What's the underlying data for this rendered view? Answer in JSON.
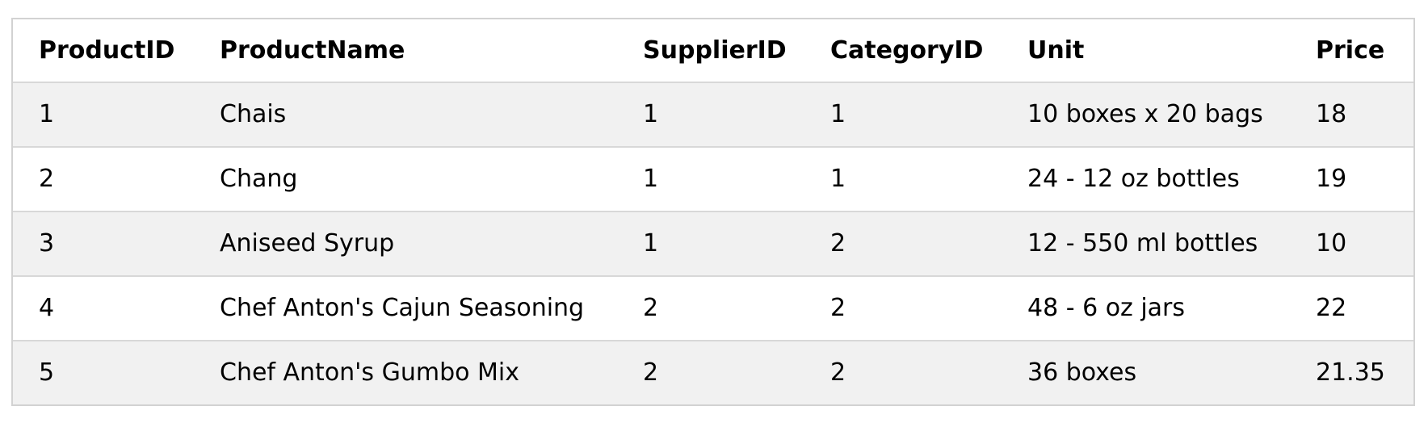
{
  "table": {
    "headers": [
      "ProductID",
      "ProductName",
      "SupplierID",
      "CategoryID",
      "Unit",
      "Price"
    ],
    "rows": [
      [
        "1",
        "Chais",
        "1",
        "1",
        "10 boxes x 20 bags",
        "18"
      ],
      [
        "2",
        "Chang",
        "1",
        "1",
        "24 - 12 oz bottles",
        "19"
      ],
      [
        "3",
        "Aniseed Syrup",
        "1",
        "2",
        "12 - 550 ml bottles",
        "10"
      ],
      [
        "4",
        "Chef Anton's Cajun Seasoning",
        "2",
        "2",
        "48 - 6 oz jars",
        "22"
      ],
      [
        "5",
        "Chef Anton's Gumbo Mix",
        "2",
        "2",
        "36 boxes",
        "21.35"
      ]
    ],
    "colors": {
      "border": "#d2d2d2",
      "row_divider": "#d8d8d8",
      "odd_row": "#f1f1f1",
      "even_row": "#ffffff"
    }
  }
}
